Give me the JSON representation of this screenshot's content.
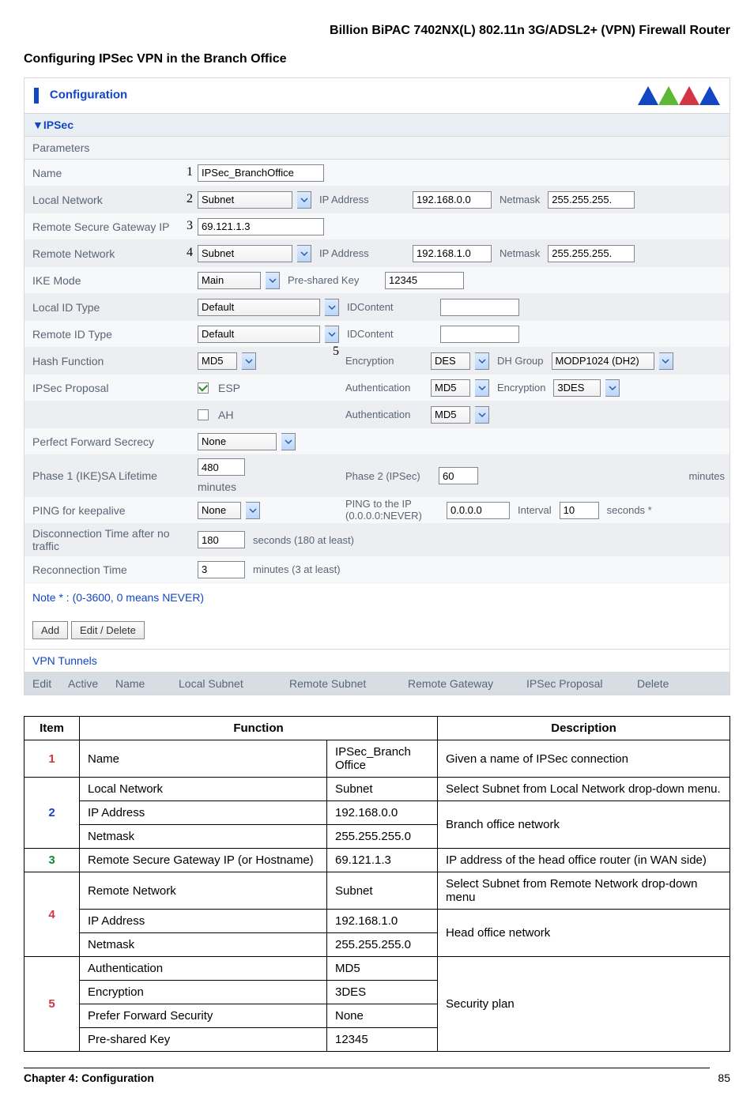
{
  "page_title": "Billion BiPAC 7402NX(L) 802.11n 3G/ADSL2+ (VPN) Firewall Router",
  "section_heading": "Configuring IPSec VPN in the Branch Office",
  "panel": {
    "title": "Configuration",
    "section": "IPSec",
    "subsection": "Parameters",
    "rows": {
      "name_label": "Name",
      "name_value": "IPSec_BranchOffice",
      "name_num": "1",
      "local_net_label": "Local Network",
      "local_net_num": "2",
      "local_net_sel": "Subnet",
      "local_ip_label": "IP Address",
      "local_ip_val": "192.168.0.0",
      "local_netmask_label": "Netmask",
      "local_netmask_val": "255.255.255.",
      "rsg_label": "Remote Secure Gateway IP",
      "rsg_num": "3",
      "rsg_val": "69.121.1.3",
      "remote_net_label": "Remote Network",
      "remote_net_num": "4",
      "remote_net_sel": "Subnet",
      "remote_ip_label": "IP Address",
      "remote_ip_val": "192.168.1.0",
      "remote_netmask_label": "Netmask",
      "remote_netmask_val": "255.255.255.",
      "ike_label": "IKE Mode",
      "ike_sel": "Main",
      "psk_label": "Pre-shared Key",
      "psk_val": "12345",
      "lid_label": "Local ID Type",
      "lid_sel": "Default",
      "lid_content": "IDContent",
      "rid_label": "Remote ID Type",
      "rid_sel": "Default",
      "rid_content": "IDContent",
      "hash_label": "Hash Function",
      "hash_sel": "MD5",
      "hash_num": "5",
      "enc_label": "Encryption",
      "enc_sel": "DES",
      "dhg_label": "DH Group",
      "dhg_sel": "MODP1024 (DH2)",
      "ipsecprop_label": "IPSec Proposal",
      "esp_label": "ESP",
      "auth_label": "Authentication",
      "auth_sel": "MD5",
      "enc2_label": "Encryption",
      "enc2_sel": "3DES",
      "ah_label": "AH",
      "auth2_label": "Authentication",
      "auth2_sel": "MD5",
      "pfs_label": "Perfect Forward Secrecy",
      "pfs_sel": "None",
      "p1_label": "Phase 1 (IKE)SA Lifetime",
      "p1_val": "480",
      "p1_unit": "minutes",
      "p2_label": "Phase 2 (IPSec)",
      "p2_val": "60",
      "p2_unit": "minutes",
      "ping_label": "PING for keepalive",
      "ping_sel": "None",
      "ping_ip_label": "PING to the IP (0.0.0.0:NEVER)",
      "ping_ip_val": "0.0.0.0",
      "interval_label": "Interval",
      "interval_val": "10",
      "interval_unit": "seconds *",
      "disc_label": "Disconnection Time after no traffic",
      "disc_val": "180",
      "disc_unit": "seconds (180 at least)",
      "recon_label": "Reconnection Time",
      "recon_val": "3",
      "recon_unit": "minutes (3 at least)"
    },
    "note": "Note * : (0-3600, 0 means NEVER)",
    "btn_add": "Add",
    "btn_edit": "Edit / Delete",
    "vpn_tunnels": "VPN Tunnels",
    "th": {
      "edit": "Edit",
      "active": "Active",
      "name": "Name",
      "local": "Local Subnet",
      "remote": "Remote Subnet",
      "rg": "Remote Gateway",
      "prop": "IPSec Proposal",
      "del": "Delete"
    }
  },
  "desc": {
    "head_item": "Item",
    "head_func": "Function",
    "head_desc": "Description",
    "r1": {
      "i": "1",
      "f": "Name",
      "v": "IPSec_Branch\nOffice",
      "d": "Given a name of IPSec connection"
    },
    "r2": {
      "i": "2",
      "f1": "Local Network",
      "v1": "Subnet",
      "d1": "Select Subnet from Local Network drop-down menu.",
      "f2": "IP Address",
      "v2": "192.168.0.0",
      "f3": "Netmask",
      "v3": "255.255.255.0",
      "d2": "Branch office network"
    },
    "r3": {
      "i": "3",
      "f": "Remote Secure Gateway IP (or Hostname)",
      "v": "69.121.1.3",
      "d": "IP address of the head office router (in WAN side)"
    },
    "r4": {
      "i": "4",
      "f1": "Remote Network",
      "v1": "Subnet",
      "d1": "Select Subnet from Remote Network drop-down menu",
      "f2": "IP Address",
      "v2": "192.168.1.0",
      "f3": "Netmask",
      "v3": "255.255.255.0",
      "d2": "Head office network"
    },
    "r5": {
      "i": "5",
      "f1": "Authentication",
      "v1": "MD5",
      "f2": "Encryption",
      "v2": "3DES",
      "f3": "Prefer Forward Security",
      "v3": "None",
      "f4": "Pre-shared Key",
      "v4": "12345",
      "d": "Security plan"
    }
  },
  "footer": {
    "chapter": "Chapter 4: Configuration",
    "page": "85"
  }
}
